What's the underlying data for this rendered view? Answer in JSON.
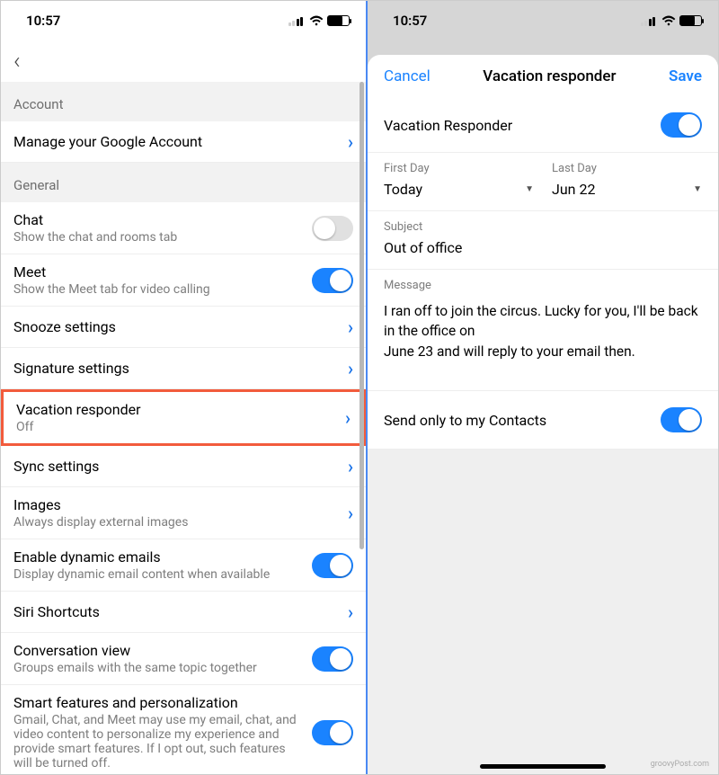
{
  "status": {
    "time": "10:57"
  },
  "left": {
    "sections": {
      "account": "Account",
      "general": "General"
    },
    "rows": {
      "manage": {
        "title": "Manage your Google Account"
      },
      "chat": {
        "title": "Chat",
        "sub": "Show the chat and rooms tab"
      },
      "meet": {
        "title": "Meet",
        "sub": "Show the Meet tab for video calling"
      },
      "snooze": {
        "title": "Snooze settings"
      },
      "signature": {
        "title": "Signature settings"
      },
      "vacation": {
        "title": "Vacation responder",
        "sub": "Off"
      },
      "sync": {
        "title": "Sync settings"
      },
      "images": {
        "title": "Images",
        "sub": "Always display external images"
      },
      "dynamic": {
        "title": "Enable dynamic emails",
        "sub": "Display dynamic email content when available"
      },
      "siri": {
        "title": "Siri Shortcuts"
      },
      "conversation": {
        "title": "Conversation view",
        "sub": "Groups emails with the same topic together"
      },
      "smart": {
        "title": "Smart features and personalization",
        "sub": "Gmail, Chat, and Meet may use my email, chat, and video content to personalize my experience and provide smart features. If I opt out, such features will be turned off."
      }
    }
  },
  "right": {
    "header": {
      "cancel": "Cancel",
      "title": "Vacation responder",
      "save": "Save"
    },
    "vr": {
      "label": "Vacation Responder"
    },
    "dates": {
      "first_label": "First Day",
      "first_value": "Today",
      "last_label": "Last Day",
      "last_value": "Jun 22"
    },
    "subject": {
      "label": "Subject",
      "value": "Out of office"
    },
    "message": {
      "label": "Message",
      "value": "I ran off to join the circus. Lucky for you, I'll be back in the office on\nJune 23 and will reply to your email then."
    },
    "send_only": {
      "label": "Send only to my Contacts"
    },
    "watermark": "groovyPost.com"
  }
}
